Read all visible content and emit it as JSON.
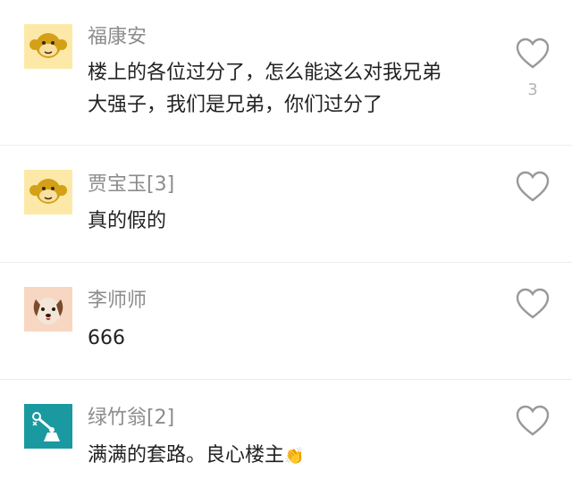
{
  "comments": [
    {
      "user": "福康安",
      "avatar": "monkey-icon",
      "lines": [
        "楼上的各位过分了，怎么能这么对我兄弟",
        "大强子，我们是兄弟，你们过分了"
      ],
      "likes": "3"
    },
    {
      "user": "贾宝玉[3]",
      "avatar": "monkey-icon",
      "lines": [
        "真的假的"
      ]
    },
    {
      "user": "李师师",
      "avatar": "dog-icon",
      "lines": [
        "666"
      ]
    },
    {
      "user": "绿竹翁[2]",
      "avatar": "robot-arm-icon",
      "lines": [
        "满满的套路。良心楼主"
      ],
      "emoji": "👏"
    }
  ],
  "icons": {
    "like": "heart-outline-icon"
  },
  "colors": {
    "username": "#8c8c8c",
    "text": "#222222",
    "heart": "#999999",
    "monkey_bg": "#fde9a7",
    "dog_bg": "#f7d7c2",
    "robot_bg": "#1a9aa0"
  }
}
